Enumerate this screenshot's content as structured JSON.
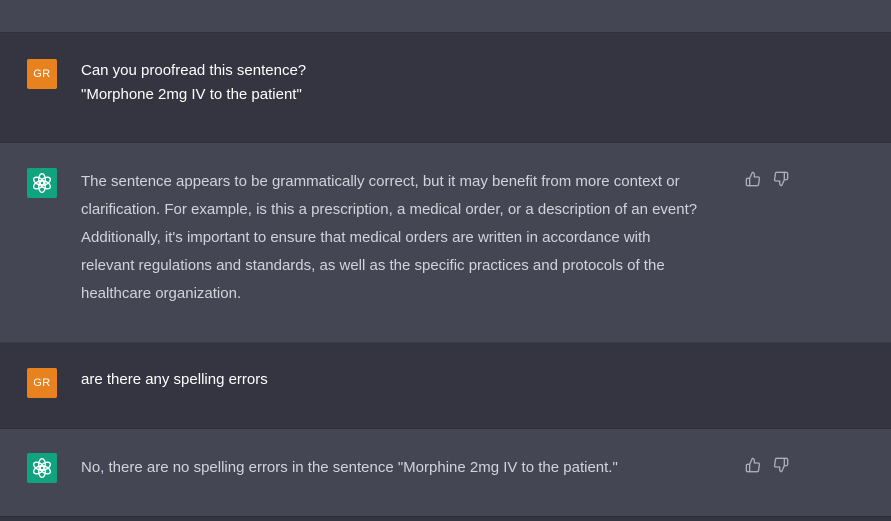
{
  "conversation": [
    {
      "role": "user",
      "avatar_initials": "GR",
      "lines": [
        "Can you proofread this sentence?",
        "\"Morphone 2mg IV to the patient\""
      ]
    },
    {
      "role": "assistant",
      "avatar_icon": "openai-logo-icon",
      "lines": [
        "The sentence appears to be grammatically correct, but it may benefit from more context or",
        "clarification. For example, is this a prescription, a medical order, or a description of an event?",
        "Additionally, it's important to ensure that medical orders are written in accordance with",
        "relevant regulations and standards, as well as the specific practices and protocols of the",
        "healthcare organization."
      ],
      "feedback_icons": [
        "thumbs-up-icon",
        "thumbs-down-icon"
      ]
    },
    {
      "role": "user",
      "avatar_initials": "GR",
      "lines": [
        "are there any spelling errors"
      ]
    },
    {
      "role": "assistant",
      "avatar_icon": "openai-logo-icon",
      "lines": [
        "No, there are no spelling errors in the sentence \"Morphine 2mg IV to the patient.\""
      ],
      "feedback_icons": [
        "thumbs-up-icon",
        "thumbs-down-icon"
      ]
    }
  ],
  "colors": {
    "user_row_bg": "#343541",
    "assistant_row_bg": "#444654",
    "user_avatar_bg": "#e8821e",
    "assistant_avatar_bg": "#10a37f",
    "user_text": "#ffffff",
    "assistant_text": "#d1d5db",
    "icon_color": "#acacbe"
  }
}
